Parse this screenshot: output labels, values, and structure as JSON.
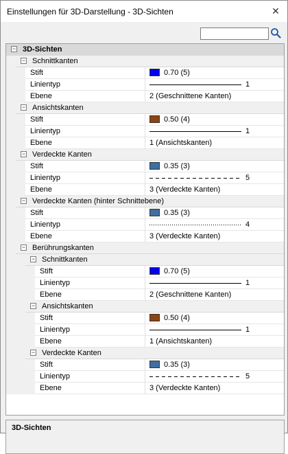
{
  "window": {
    "title": "Einstellungen für 3D-Darstellung - 3D-Sichten",
    "close_symbol": "✕"
  },
  "search": {
    "placeholder": "",
    "value": ""
  },
  "grid": {
    "root": "3D-Sichten",
    "labels": {
      "pen": "Stift",
      "linetype": "Linientyp",
      "layer": "Ebene"
    },
    "toggle_symbol": "⊟",
    "sections": [
      {
        "id": "schnitt",
        "label": "Schnittkanten",
        "pen_color": "#0000ee",
        "pen": "0.70 (5)",
        "line_style": "solid",
        "line_num": "1",
        "layer": "2 (Geschnittene Kanten)"
      },
      {
        "id": "ansicht",
        "label": "Ansichtskanten",
        "pen_color": "#8b4513",
        "pen": "0.50 (4)",
        "line_style": "solid",
        "line_num": "1",
        "layer": "1 (Ansichtskanten)"
      },
      {
        "id": "verdeckt",
        "label": "Verdeckte Kanten",
        "pen_color": "#3f6fa0",
        "pen": "0.35 (3)",
        "line_style": "dashed",
        "line_num": "5",
        "layer": "3 (Verdeckte Kanten)"
      },
      {
        "id": "verdeckt-hinter",
        "label": "Verdeckte Kanten (hinter Schnittebene)",
        "pen_color": "#3f6fa0",
        "pen": "0.35 (3)",
        "line_style": "dotted",
        "line_num": "4",
        "layer": "3 (Verdeckte Kanten)"
      }
    ],
    "beruehrung": {
      "label": "Berührungskanten",
      "children": [
        {
          "id": "b-schnitt",
          "label": "Schnittkanten",
          "pen_color": "#0000ee",
          "pen": "0.70 (5)",
          "line_style": "solid",
          "line_num": "1",
          "layer": "2 (Geschnittene Kanten)"
        },
        {
          "id": "b-ansicht",
          "label": "Ansichtskanten",
          "pen_color": "#8b4513",
          "pen": "0.50 (4)",
          "line_style": "solid",
          "line_num": "1",
          "layer": "1 (Ansichtskanten)"
        },
        {
          "id": "b-verdeckt",
          "label": "Verdeckte Kanten",
          "pen_color": "#3f6fa0",
          "pen": "0.35 (3)",
          "line_style": "dashed",
          "line_num": "5",
          "layer": "3 (Verdeckte Kanten)"
        }
      ]
    }
  },
  "description": {
    "title": "3D-Sichten"
  },
  "icons": {
    "search": "search-icon",
    "close": "close-icon",
    "collapse": "collapse-toggle-icon"
  }
}
